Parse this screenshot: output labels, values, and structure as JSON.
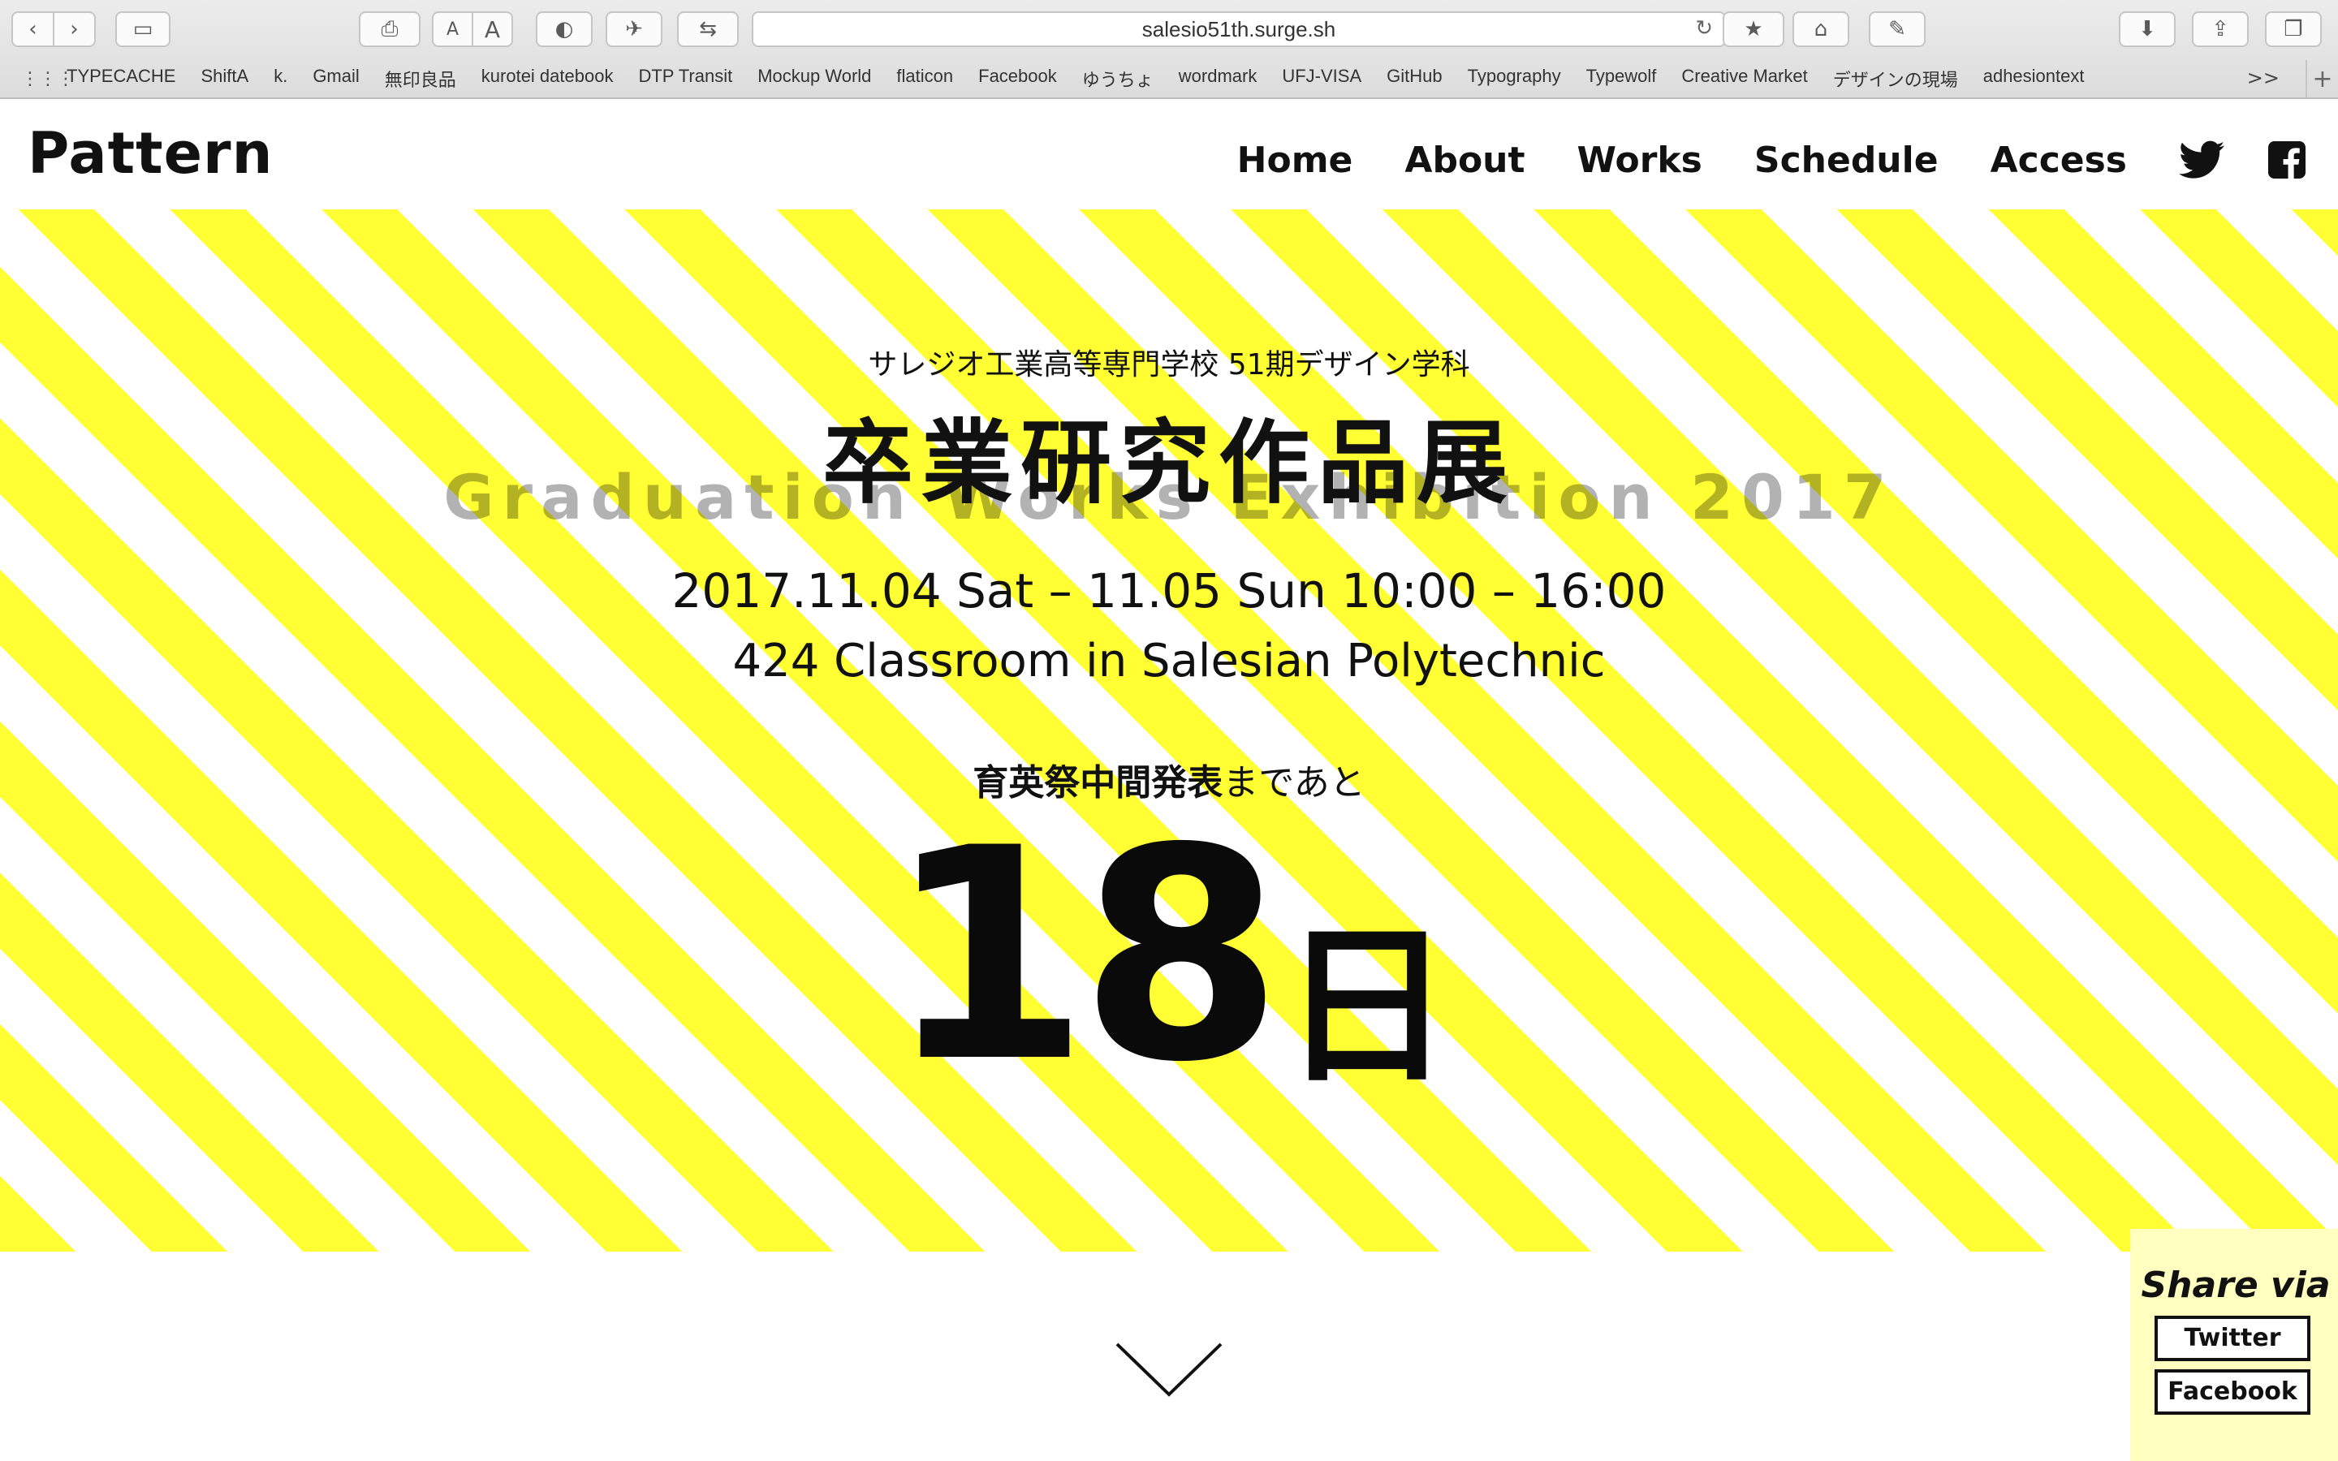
{
  "browser": {
    "url": "salesio51th.surge.sh",
    "text_size_small": "A",
    "text_size_large": "A",
    "bookmarks": [
      "TYPECACHE",
      "ShiftA",
      "k.",
      "Gmail",
      "無印良品",
      "kurotei datebook",
      "DTP Transit",
      "Mockup World",
      "flaticon",
      "Facebook",
      "ゆうちょ",
      "wordmark",
      "UFJ-VISA",
      "GitHub",
      "Typography",
      "Typewolf",
      "Creative Market",
      "デザインの現場",
      "adhesiontext"
    ],
    "bookmarks_overflow": ">>"
  },
  "site": {
    "logo": "Pattern",
    "nav": {
      "home": "Home",
      "about": "About",
      "works": "Works",
      "schedule": "Schedule",
      "access": "Access"
    },
    "social_icons": [
      "twitter-icon",
      "facebook-icon"
    ]
  },
  "hero": {
    "school": "サレジオ工業高等専門学校 51期デザイン学科",
    "title": "卒業研究作品展",
    "subtitle_en": "Graduation Works Exhibition 2017",
    "date": "2017.11.04 Sat – 11.05 Sun 10:00 – 16:00",
    "venue": "424 Classroom in Salesian Polytechnic",
    "countdown_label_bold": "育英祭中間発表",
    "countdown_label_rest": "まであと",
    "countdown_number": "18",
    "countdown_unit": "日",
    "stripe_colors": [
      "#ffff33",
      "#ffffff"
    ]
  },
  "share": {
    "title": "Share via",
    "twitter": "Twitter",
    "facebook": "Facebook",
    "background": "#ffffbf"
  }
}
